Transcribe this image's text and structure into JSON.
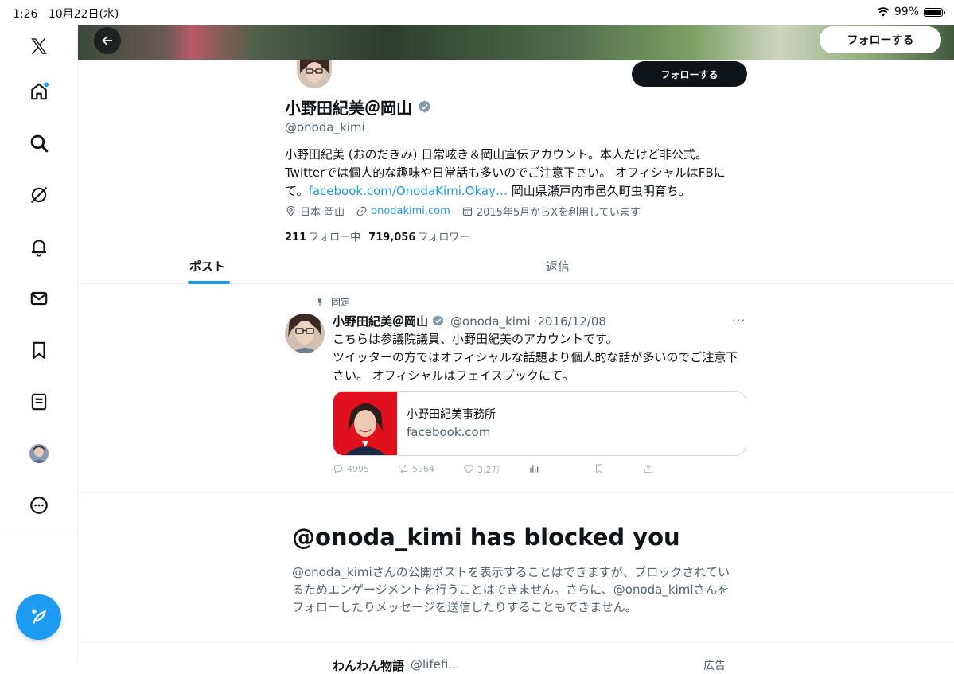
{
  "status_bar": {
    "time": "1:26",
    "date": "10月22日(水)",
    "battery": "99%"
  },
  "sidebar": {
    "items": [
      {
        "name": "x-logo-icon"
      },
      {
        "name": "home-icon"
      },
      {
        "name": "search-icon"
      },
      {
        "name": "grok-icon"
      },
      {
        "name": "notifications-icon"
      },
      {
        "name": "messages-icon"
      },
      {
        "name": "bookmarks-icon"
      },
      {
        "name": "lists-icon"
      },
      {
        "name": "profile-avatar"
      },
      {
        "name": "more-icon"
      }
    ],
    "compose_icon": "compose-icon"
  },
  "header": {
    "follow_label": "フォローする"
  },
  "profile": {
    "follow_label": "フォローする",
    "name": "小野田紀美＠岡山",
    "handle": "@onoda_kimi",
    "bio_line1": "小野田紀美 (おのだきみ) 日常呟き＆岡山宣伝アカウント。本人だけど非公式。",
    "bio_line2": "Twitterでは個人的な趣味や日常話も多いのでご注意下さい。 オフィシャルはFBに",
    "bio_line3_a": "て。",
    "bio_link": "facebook.com/OnodaKimi.Okay…",
    "bio_line3_b": " 岡山県瀬戸内市邑久町虫明育ち。",
    "location": "日本 岡山",
    "website": "onodakimi.com",
    "joined": "2015年5月からXを利用しています",
    "following_count": "211",
    "following_label": "フォロー中",
    "followers_count": "719,056",
    "followers_label": "フォロワー"
  },
  "tabs": [
    {
      "label": "ポスト"
    },
    {
      "label": "返信"
    }
  ],
  "pinned_tweet": {
    "pinned_label": "固定",
    "name": "小野田紀美＠岡山",
    "handle": "@onoda_kimi",
    "date": "·2016/12/08",
    "more": "···",
    "text_line1": "こちらは参議院議員、小野田紀美のアカウントです。",
    "text_line2": "ツイッターの方ではオフィシャルな話題より個人的な話が多いのでご注意下",
    "text_line3": "さい。 オフィシャルはフェイスブックにて。",
    "card_title": "小野田紀美事務所",
    "card_domain": "facebook.com",
    "replies": "4995",
    "retweets": "5964",
    "likes": "3.2万"
  },
  "blocked": {
    "title": "@onoda_kimi has blocked you",
    "text_line1": "@onoda_kimiさんの公開ポストを表示することはできますが、ブロックされてい",
    "text_line2": "るためエンゲージメントを行うことはできません。さらに、@onoda_kimiさんを",
    "text_line3": "フォローしたりメッセージを送信したりすることもできません。"
  },
  "next_tweet": {
    "name": "わんわん物語",
    "handle": "@lifefi...",
    "ad_label": "広告"
  },
  "colors": {
    "accent": "#1d9bf0",
    "text": "#0f1419",
    "muted": "#536471"
  }
}
